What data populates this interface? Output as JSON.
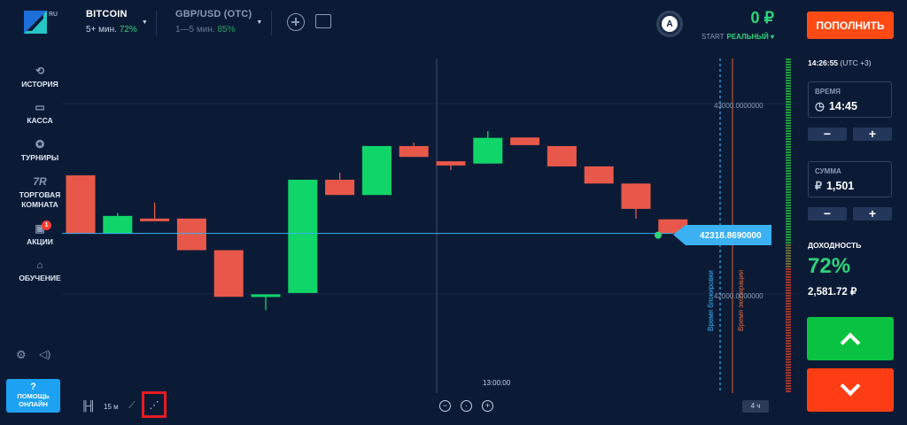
{
  "header": {
    "logo_suffix": "RU",
    "assets": [
      {
        "name": "BITCOIN",
        "term": "5+ мин.",
        "payout": "72%"
      },
      {
        "name": "GBP/USD (OTC)",
        "term": "1—5 мин.",
        "payout": "85%"
      }
    ],
    "avatar_letter": "A",
    "balance": "0 ₽",
    "account_prefix": "START",
    "account_type": "РЕАЛЬНЫЙ ▾",
    "deposit_label": "ПОПОЛНИТЬ"
  },
  "sidebar": {
    "items": [
      {
        "label": "ИСТОРИЯ",
        "icon": "history-icon"
      },
      {
        "label": "КАССА",
        "icon": "wallet-icon"
      },
      {
        "label": "ТУРНИРЫ",
        "icon": "star-icon"
      },
      {
        "label": "ТОРГОВАЯ КОМНАТА",
        "icon": "trading-room-icon",
        "glyph": "7R"
      },
      {
        "label": "АКЦИИ",
        "icon": "gift-icon",
        "badge": "1"
      },
      {
        "label": "ОБУЧЕНИЕ",
        "icon": "graduation-cap-icon"
      }
    ],
    "help_mark": "?",
    "help_line1": "ПОМОЩЬ",
    "help_line2": "ОНЛАЙН"
  },
  "toolbar": {
    "interval": "15 м",
    "timeframe": "4 ч"
  },
  "chart_data": {
    "type": "candlestick",
    "y_ticks": [
      "43000.0000000",
      "42000.0000000"
    ],
    "x_tick": "13:00:00",
    "current_price": "42318.8690000",
    "purchase_deadline_label": "Время блокировки",
    "expiry_label": "Время экспирации",
    "candles": [
      {
        "open": 42623,
        "close": 42318,
        "high": 42623,
        "low": 42318,
        "color": "red"
      },
      {
        "open": 42318,
        "close": 42410,
        "high": 42425,
        "low": 42318,
        "color": "green"
      },
      {
        "open": 42396,
        "close": 42396,
        "high": 42480,
        "low": 42396,
        "color": "red"
      },
      {
        "open": 42396,
        "close": 42230,
        "high": 42396,
        "low": 42230,
        "color": "red"
      },
      {
        "open": 42230,
        "close": 41985,
        "high": 42230,
        "low": 41985,
        "color": "red"
      },
      {
        "open": 41990,
        "close": 41998,
        "high": 41998,
        "low": 41915,
        "color": "green"
      },
      {
        "open": 42005,
        "close": 42600,
        "high": 42600,
        "low": 42005,
        "color": "green"
      },
      {
        "open": 42600,
        "close": 42520,
        "high": 42637,
        "low": 42520,
        "color": "red"
      },
      {
        "open": 42520,
        "close": 42777,
        "high": 42777,
        "low": 42520,
        "color": "green"
      },
      {
        "open": 42777,
        "close": 42720,
        "high": 42795,
        "low": 42720,
        "color": "red"
      },
      {
        "open": 42697,
        "close": 42675,
        "high": 42697,
        "low": 42650,
        "color": "red"
      },
      {
        "open": 42685,
        "close": 42820,
        "high": 42855,
        "low": 42685,
        "color": "green"
      },
      {
        "open": 42822,
        "close": 42782,
        "high": 42822,
        "low": 42782,
        "color": "red"
      },
      {
        "open": 42777,
        "close": 42670,
        "high": 42777,
        "low": 42670,
        "color": "red"
      },
      {
        "open": 42670,
        "close": 42580,
        "high": 42670,
        "low": 42580,
        "color": "red"
      },
      {
        "open": 42580,
        "close": 42447,
        "high": 42580,
        "low": 42395,
        "color": "red"
      },
      {
        "open": 42392,
        "close": 42318,
        "high": 42392,
        "low": 42318,
        "color": "red"
      }
    ]
  },
  "panel": {
    "clock": "14:26:55",
    "timezone": "(UTC +3)",
    "time_label": "ВРЕМЯ",
    "time_value": "14:45",
    "amount_label": "СУММА",
    "amount_symbol": "₽",
    "amount_value": "1,501",
    "minus": "−",
    "plus": "+",
    "payout_label": "ДОХОДНОСТЬ",
    "payout_pct": "72%",
    "payout_sum": "2,581.72 ₽"
  },
  "colors": {
    "background": "#0b1b36",
    "up": "#10d66a",
    "down": "#e8584a",
    "price_tag": "#3bb0f2",
    "deposit": "#ff4b13",
    "call": "#0ac241",
    "put": "#ff3d14"
  }
}
